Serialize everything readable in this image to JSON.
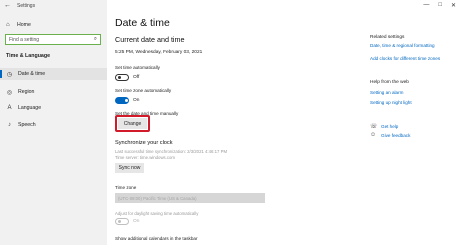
{
  "window": {
    "title": "Settings",
    "controls": {
      "minimize": "—",
      "maximize": "□",
      "close": "✕"
    }
  },
  "sidebar": {
    "home_label": "Home",
    "search_placeholder": "Find a setting",
    "section_title": "Time & Language",
    "items": [
      {
        "label": "Date & time",
        "icon": "calendar-clock-icon",
        "active": true
      },
      {
        "label": "Region",
        "icon": "globe-icon",
        "active": false
      },
      {
        "label": "Language",
        "icon": "language-icon",
        "active": false
      },
      {
        "label": "Speech",
        "icon": "microphone-icon",
        "active": false
      }
    ]
  },
  "main": {
    "page_title": "Date & time",
    "current_heading": "Current date and time",
    "current_value": "5:25 PM, Wednesday, February 03, 2021",
    "set_time_auto": {
      "label": "Set time automatically",
      "state": "Off"
    },
    "set_zone_auto": {
      "label": "Set time zone automatically",
      "state": "On"
    },
    "manual_label": "Set the date and time manually",
    "change_button": "Change",
    "sync_heading": "Synchronize your clock",
    "sync_last": "Last successful time synchronization: 2/3/2021 4:46:17 PM",
    "sync_server": "Time server: time.windows.com",
    "sync_button": "Sync now",
    "timezone_label": "Time zone",
    "timezone_value": "(UTC-08:00) Pacific Time (US & Canada)",
    "dst_label": "Adjust for daylight saving time automatically",
    "dst_state": "On",
    "calendars_label": "Show additional calendars in the taskbar"
  },
  "related": {
    "heading": "Related settings",
    "links": [
      "Date, time & regional formatting",
      "Add clocks for different time zones"
    ],
    "help_heading": "Help from the web",
    "help_links": [
      "Setting an alarm",
      "Setting up night light"
    ],
    "get_help": "Get help",
    "give_feedback": "Give feedback"
  },
  "colors": {
    "accent": "#0067c0",
    "highlight": "#d11a2a",
    "search_border": "#6ab04c"
  }
}
